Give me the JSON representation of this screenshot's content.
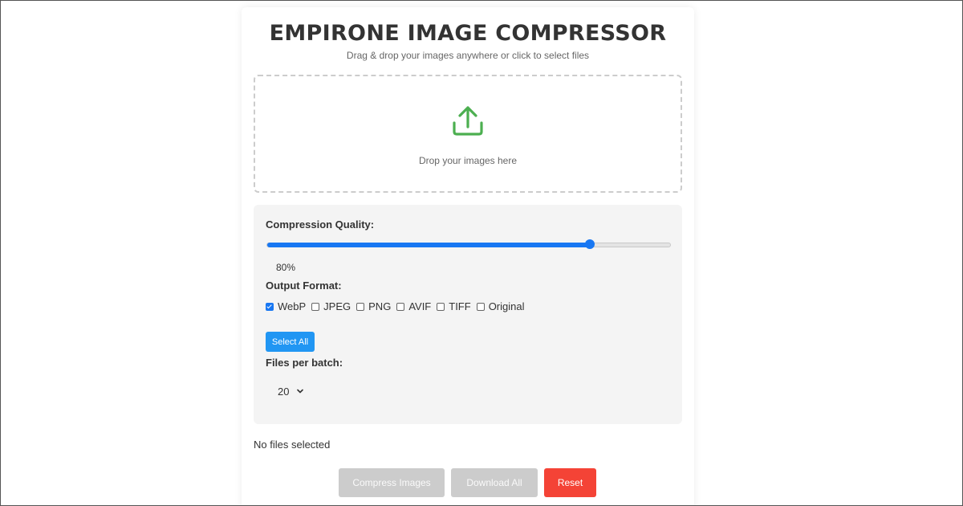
{
  "header": {
    "title": "EMPIRONE IMAGE COMPRESSOR",
    "subtitle": "Drag & drop your images anywhere or click to select files"
  },
  "dropzone": {
    "icon": "upload-icon",
    "text": "Drop your images here"
  },
  "settings": {
    "quality_label": "Compression Quality:",
    "quality_value": 80,
    "quality_display": "80%",
    "format_label": "Output Format:",
    "formats": [
      {
        "label": "WebP",
        "checked": true
      },
      {
        "label": "JPEG",
        "checked": false
      },
      {
        "label": "PNG",
        "checked": false
      },
      {
        "label": "AVIF",
        "checked": false
      },
      {
        "label": "TIFF",
        "checked": false
      },
      {
        "label": "Original",
        "checked": false
      }
    ],
    "select_all_label": "Select All",
    "batch_label": "Files per batch:",
    "batch_value": "20"
  },
  "status": {
    "files": "No files selected"
  },
  "actions": {
    "compress_label": "Compress Images",
    "download_label": "Download All",
    "reset_label": "Reset"
  },
  "colors": {
    "accent": "#1877f2",
    "button_blue": "#2196f3",
    "upload_green": "#4caf50",
    "reset_red": "#f44336",
    "disabled_gray": "#cccccc"
  }
}
